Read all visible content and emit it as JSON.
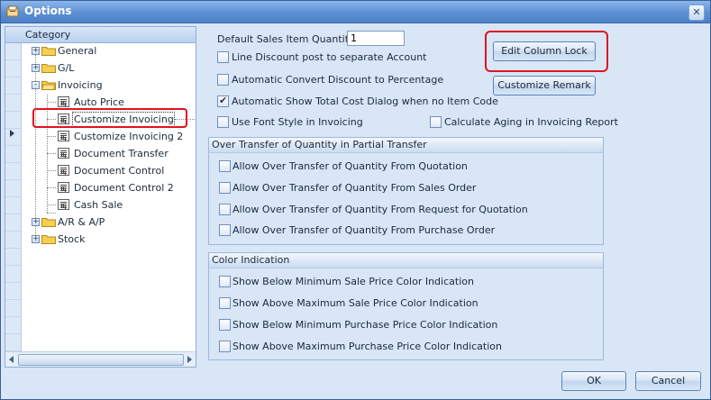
{
  "window": {
    "title": "Options",
    "close_glyph": "✕"
  },
  "tree": {
    "header": "Category",
    "items": [
      {
        "label": "General",
        "expander": "+"
      },
      {
        "label": "G/L",
        "expander": "+"
      },
      {
        "label": "Invoicing",
        "expander": "-"
      },
      {
        "label": "Auto Price"
      },
      {
        "label": "Customize Invoicing"
      },
      {
        "label": "Customize Invoicing 2"
      },
      {
        "label": "Document Transfer"
      },
      {
        "label": "Document Control"
      },
      {
        "label": "Document Control 2"
      },
      {
        "label": "Cash Sale"
      },
      {
        "label": "A/R & A/P",
        "expander": "+"
      },
      {
        "label": "Stock",
        "expander": "+"
      }
    ]
  },
  "settings": {
    "default_qty_label": "Default Sales Item Quantity:",
    "default_qty_value": "1",
    "line_discount": "Line Discount post to separate Account",
    "auto_convert_discount": "Automatic Convert Discount to Percentage",
    "auto_show_cost": "Automatic Show Total Cost Dialog when no Item Code",
    "font_style": "Use Font Style in Invoicing",
    "calc_aging": "Calculate Aging in Invoicing Report"
  },
  "buttons": {
    "edit_column_lock": "Edit Column Lock",
    "customize_remark": "Customize Remark",
    "ok": "OK",
    "cancel": "Cancel"
  },
  "over_transfer": {
    "title": "Over Transfer of Quantity in Partial Transfer",
    "items": [
      "Allow Over Transfer of Quantity From Quotation",
      "Allow Over Transfer of Quantity From Sales Order",
      "Allow Over Transfer of Quantity From Request for Quotation",
      "Allow Over Transfer of Quantity From Purchase Order"
    ]
  },
  "color_indication": {
    "title": "Color Indication",
    "items": [
      "Show Below Minimum Sale Price Color Indication",
      "Show Above Maximum Sale Price Color Indication",
      "Show Below Minimum Purchase Price Color Indication",
      "Show Above Maximum Purchase Price Color Indication"
    ]
  },
  "colors": {
    "highlight": "#e0141e",
    "title_bar": "#5c8fd3",
    "background": "#d8e6f6"
  }
}
